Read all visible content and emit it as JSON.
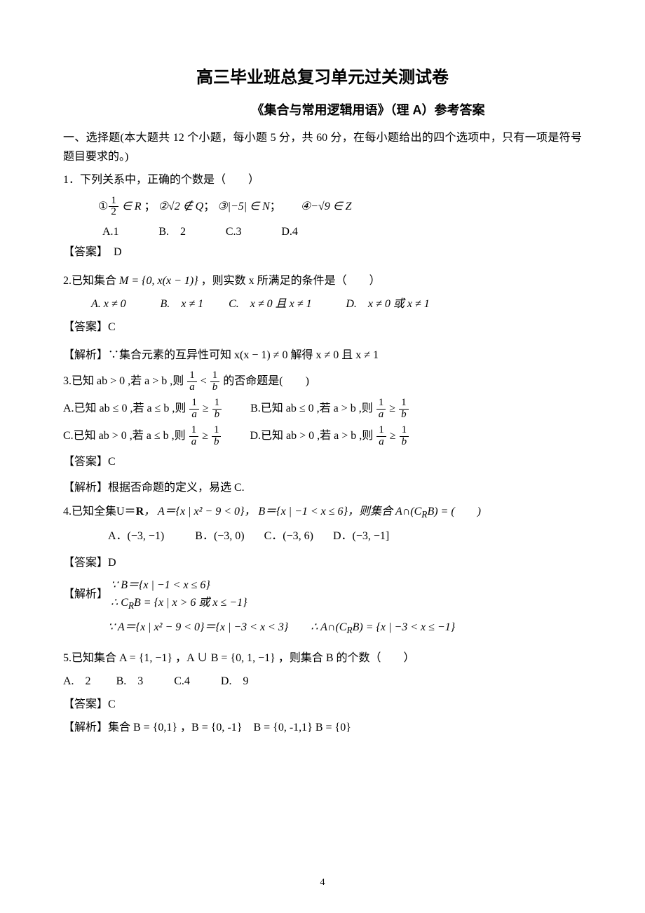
{
  "title": "高三毕业班总复习单元过关测试卷",
  "subtitle": "《集合与常用逻辑用语》（理 A）参考答案",
  "section_intro": "一、选择题(本大题共 12 个小题，每小题 5 分，共 60 分，在每小题给出的四个选项中，只有一项是符号题目要求的。)",
  "q1": {
    "stem": "1．下列关系中，正确的个数是（　　）",
    "items_joiner": "；  ",
    "item1_pre": "①",
    "item1_post": " ∈ R",
    "item2": "②√2 ∉ Q",
    "item3": "③|−5| ∈ N",
    "item4": "④−√9 ∈ Z",
    "optA": "A.1",
    "optB": "B.　2",
    "optC": "C.3",
    "optD": "D.4",
    "answer": "【答案】　D"
  },
  "q2": {
    "stem_pre": "2.已知集合 ",
    "stem_mid": "M = {0, x(x − 1)}",
    "stem_post": " ，则实数 x 所满足的条件是（　　）",
    "optA": "A. x ≠ 0",
    "optB": "B.　x ≠ 1",
    "optC": "C.　x ≠ 0 且 x ≠ 1",
    "optD": "D.　x ≠ 0 或 x ≠ 1",
    "answer": "【答案】C",
    "explain": "【解析】∵集合元素的互异性可知 x(x − 1) ≠ 0 解得 x ≠ 0 且 x ≠ 1"
  },
  "q3": {
    "stem_pre": "3.已知 ab > 0 ,若 a > b ,则 ",
    "stem_mid": " < ",
    "stem_post": " 的否命题是(　　)",
    "rowA_pre": "A.已知 ab ≤ 0 ,若 a ≤ b ,则 ",
    "rowB_pre": "B.已知 ab ≤ 0 ,若 a > b ,则 ",
    "rowC_pre": "C.已知 ab > 0 ,若 a ≤ b ,则 ",
    "rowD_pre": "D.已知 ab > 0 ,若 a > b ,则 ",
    "ge": " ≥ ",
    "answer": "【答案】C",
    "explain": "【解析】根据否命题的定义，易选 C."
  },
  "q4": {
    "stem_pre": "4.已知全集U＝",
    "stem_R": "R",
    "stem_mid1": "， A＝{x | x² − 9 < 0}， B＝{x | −1 < x ≤ 6}，则集合 A∩(C",
    "stem_sub": "R",
    "stem_mid2": "B) = (　　)",
    "optA": "A．(−3, −1)",
    "optB": "B．(−3, 0)",
    "optC": "C．(−3, 6)",
    "optD": "D．(−3, −1]",
    "answer": "【答案】D",
    "explain_label": "【解析】",
    "ex_line1": "∵ B＝{x | −1 < x ≤ 6}",
    "ex_line2_a": "∴ C",
    "ex_line2_b": "B = {x | x > 6 或 x ≤ −1}",
    "ex_line3_a": "∵ A＝{x | x² − 9 < 0}＝{x | −3 < x < 3}　　∴ A∩(C",
    "ex_line3_b": "B) = {x | −3 < x ≤ −1}"
  },
  "q5": {
    "stem": "5.已知集合 A = {1, −1} ，A ∪ B = {0, 1, −1} ，则集合 B 的个数（　　）",
    "optA": "A.　2",
    "optB": "B.　3",
    "optC": "C.4",
    "optD": "D.　9",
    "answer": "【答案】C",
    "explain": "【解析】集合 B = {0,1}  ，B = {0,  -1}　B = {0,  -1,1}  B = {0}"
  },
  "page_number": "4"
}
